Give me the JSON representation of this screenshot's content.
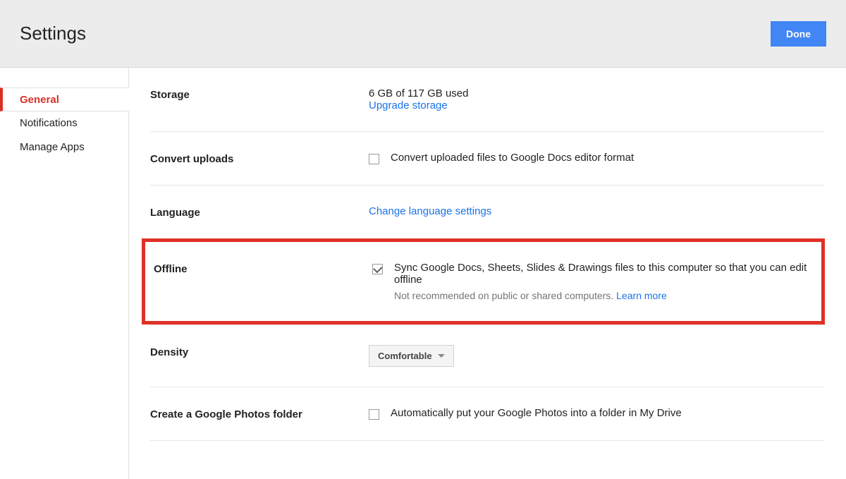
{
  "header": {
    "title": "Settings",
    "done_label": "Done"
  },
  "sidebar": {
    "items": [
      {
        "label": "General",
        "active": true
      },
      {
        "label": "Notifications",
        "active": false
      },
      {
        "label": "Manage Apps",
        "active": false
      }
    ]
  },
  "sections": {
    "storage": {
      "label": "Storage",
      "usage": "6 GB of 117 GB used",
      "upgrade_link": "Upgrade storage"
    },
    "convert": {
      "label": "Convert uploads",
      "checked": false,
      "text": "Convert uploaded files to Google Docs editor format"
    },
    "language": {
      "label": "Language",
      "link": "Change language settings"
    },
    "offline": {
      "label": "Offline",
      "checked": true,
      "text": "Sync Google Docs, Sheets, Slides & Drawings files to this computer so that you can edit offline",
      "note": "Not recommended on public or shared computers. ",
      "learn_more": "Learn more"
    },
    "density": {
      "label": "Density",
      "value": "Comfortable"
    },
    "photos": {
      "label": "Create a Google Photos folder",
      "checked": false,
      "text": "Automatically put your Google Photos into a folder in My Drive"
    }
  }
}
